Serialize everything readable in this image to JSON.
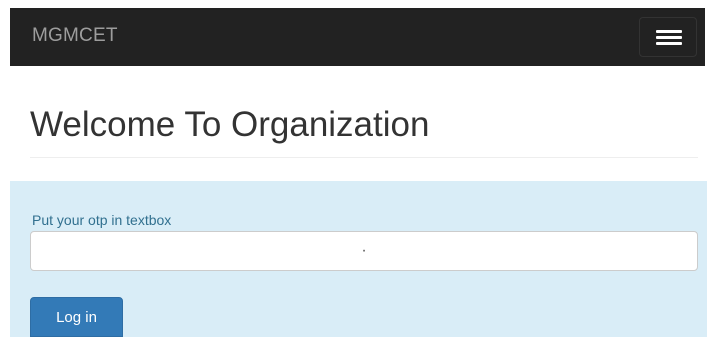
{
  "navbar": {
    "brand": "MGMCET",
    "toggle_icon": "hamburger-menu-icon"
  },
  "header": {
    "title": "Welcome To Organization"
  },
  "otp_form": {
    "label": "Put your otp in textbox",
    "input_value": "·",
    "button_label": "Log in"
  },
  "colors": {
    "navbar_bg": "#222222",
    "panel_bg": "#d9edf7",
    "label_color": "#31708f",
    "button_bg": "#337ab7"
  }
}
